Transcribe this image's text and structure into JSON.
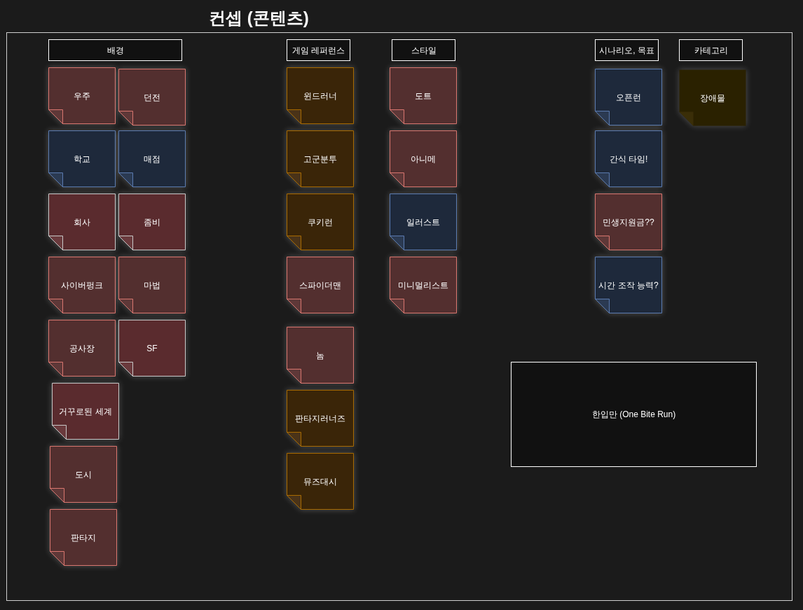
{
  "title": "컨셉 (콘텐츠)",
  "sections": [
    {
      "header": "배경",
      "notes": [
        {
          "text": "우주",
          "color": "#532f2f"
        },
        {
          "text": "던전",
          "color": "#532f2f"
        },
        {
          "text": "학교",
          "color": "#1e293b"
        },
        {
          "text": "매점",
          "color": "#1e293b"
        },
        {
          "text": "회사",
          "color": "#5a2b2e"
        },
        {
          "text": "좀비",
          "color": "#5a2b2e"
        },
        {
          "text": "사이버펑크",
          "color": "#532f2f"
        },
        {
          "text": "마법",
          "color": "#532f2f"
        },
        {
          "text": "공사장",
          "color": "#532f2f"
        },
        {
          "text": "SF",
          "color": "#5a2b2e"
        },
        {
          "text": "거꾸로된 세계",
          "color": "#5a2b2e"
        },
        {
          "text": "도시",
          "color": "#532f2f"
        },
        {
          "text": "판타지",
          "color": "#532f2f"
        }
      ]
    },
    {
      "header": "게임 레퍼런스",
      "notes": [
        {
          "text": "윈드러너",
          "color": "#3a2508"
        },
        {
          "text": "고군분투",
          "color": "#3a2508"
        },
        {
          "text": "쿠키런",
          "color": "#3a2508"
        },
        {
          "text": "스파이더맨",
          "color": "#532f2f"
        },
        {
          "text": "놈",
          "color": "#532f2f"
        },
        {
          "text": "판타지러너즈",
          "color": "#3a2508"
        },
        {
          "text": "뮤즈대시",
          "color": "#3a2508"
        }
      ]
    },
    {
      "header": "스타일",
      "notes": [
        {
          "text": "도트",
          "color": "#532f2f"
        },
        {
          "text": "아니메",
          "color": "#532f2f"
        },
        {
          "text": "일러스트",
          "color": "#1e293b"
        },
        {
          "text": "미니멀리스트",
          "color": "#532f2f"
        }
      ]
    },
    {
      "header": "시나리오, 목표",
      "notes": [
        {
          "text": "오픈런",
          "color": "#1e293b"
        },
        {
          "text": "간식 타임!",
          "color": "#1e293b"
        },
        {
          "text": "민생지원금??",
          "color": "#532f2f"
        },
        {
          "text": "시간 조작 능력?",
          "color": "#1e293b"
        }
      ]
    },
    {
      "header": "카테고리",
      "notes": [
        {
          "text": "장애물",
          "color": "#2a2100"
        }
      ]
    }
  ],
  "concept_box": "한입만 (One Bite Run)"
}
